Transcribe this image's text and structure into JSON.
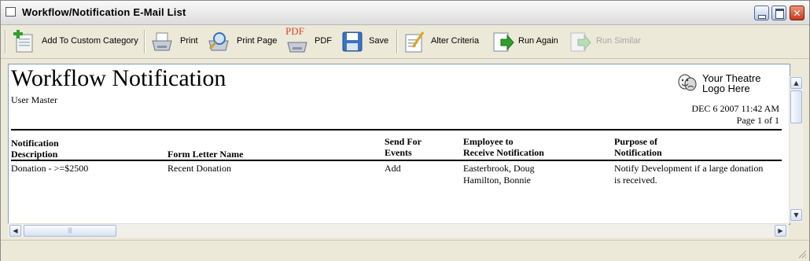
{
  "window": {
    "title": "Workflow/Notification E-Mail List"
  },
  "toolbar": {
    "add_to_custom_category": "Add To Custom Category",
    "print": "Print",
    "print_page": "Print Page",
    "pdf": "PDF",
    "pdf_icon_text": "PDF",
    "save": "Save",
    "alter_criteria": "Alter Criteria",
    "run_again": "Run Again",
    "run_similar": "Run Similar",
    "run_similar_enabled": false
  },
  "report": {
    "title": "Workflow Notification",
    "subtitle": "User Master",
    "logo_line1": "Your Theatre",
    "logo_line2": "Logo Here",
    "date": "DEC 6 2007 11:42 AM",
    "page": "Page 1 of 1",
    "columns": {
      "notification_desc_1": "Notification",
      "notification_desc_2": "Description",
      "form_letter": "Form Letter Name",
      "send_for_1": "Send For",
      "send_for_2": "Events",
      "employee_1": "Employee to",
      "employee_2": "Receive Notification",
      "purpose_1": "Purpose of",
      "purpose_2": "Notification"
    },
    "rows": [
      {
        "description": "Donation - >=$2500",
        "form_letter": "Recent Donation",
        "send_for": "Add",
        "employee_1": "Easterbrook, Doug",
        "employee_2": "Hamilton, Bonnie",
        "purpose_1": "Notify Development if a large donation",
        "purpose_2": "is received."
      }
    ]
  },
  "icons": [
    "window-icon",
    "add-category-icon",
    "print-icon",
    "print-page-icon",
    "pdf-icon",
    "save-icon",
    "alter-criteria-icon",
    "run-again-icon",
    "run-similar-icon",
    "logo-icon"
  ],
  "colors": {
    "window_bg": "#ece9d8",
    "close_button": "#c23b1c",
    "pdf_red": "#d9432b"
  }
}
